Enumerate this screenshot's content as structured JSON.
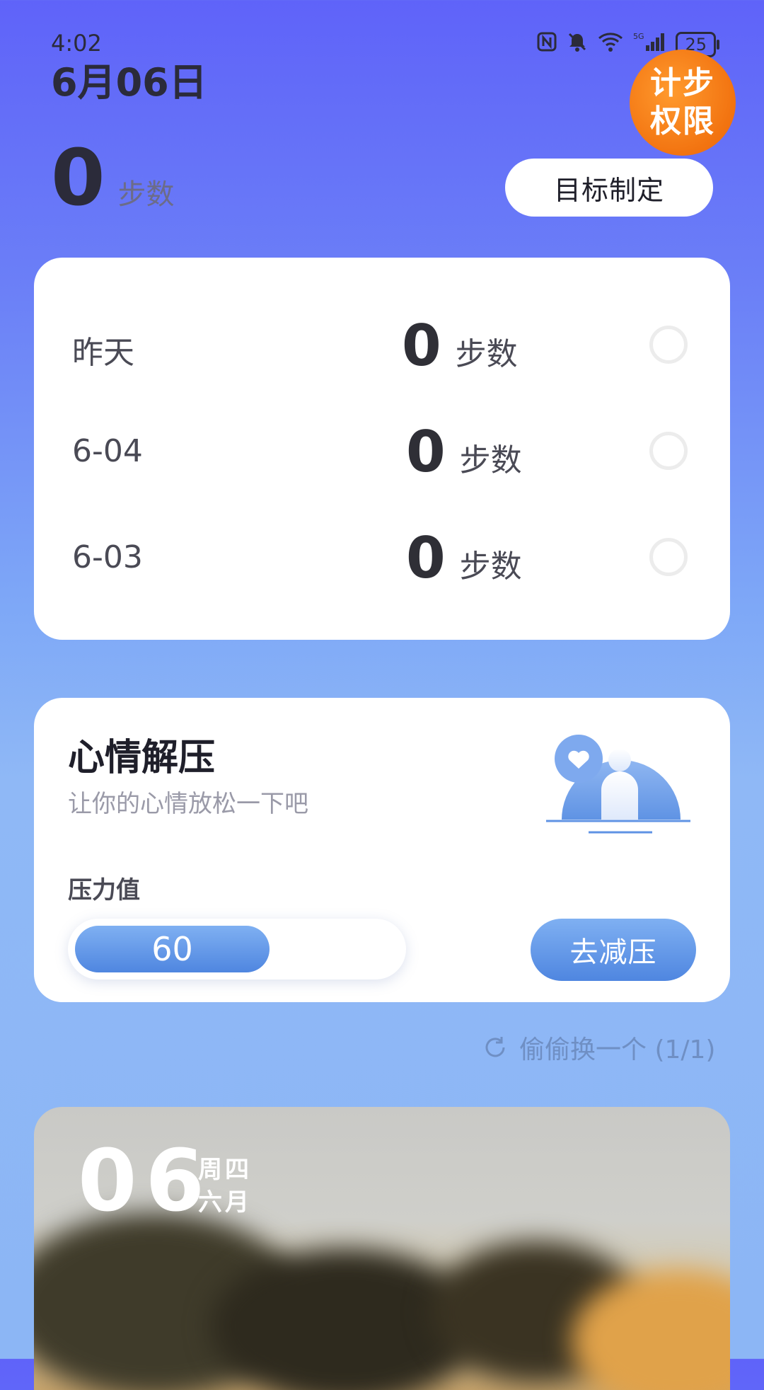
{
  "status_bar": {
    "time": "4:02",
    "battery": "25",
    "icons": [
      "nfc-icon",
      "bell-off-icon",
      "wifi-icon",
      "signal-5g-icon",
      "battery-icon"
    ]
  },
  "header": {
    "date": "6月06日",
    "permission_badge": {
      "line1": "计步",
      "line2": "权限"
    },
    "today_steps": "0",
    "today_unit": "步数",
    "goal_button": "目标制定"
  },
  "history": {
    "rows": [
      {
        "date": "昨天",
        "steps": "0",
        "unit": "步数"
      },
      {
        "date": "6-04",
        "steps": "0",
        "unit": "步数"
      },
      {
        "date": "6-03",
        "steps": "0",
        "unit": "步数"
      }
    ]
  },
  "mood": {
    "title": "心情解压",
    "subtitle": "让你的心情放松一下吧",
    "pressure_label": "压力值",
    "pressure_value": "60",
    "pressure_fraction": 0.6,
    "relax_button": "去减压",
    "colors": {
      "accent": "#4f86e0"
    }
  },
  "swap": {
    "label": "偷偷换一个 (1/1)"
  },
  "photo_card": {
    "day": "06",
    "weekday": "周四",
    "month": "六月"
  }
}
